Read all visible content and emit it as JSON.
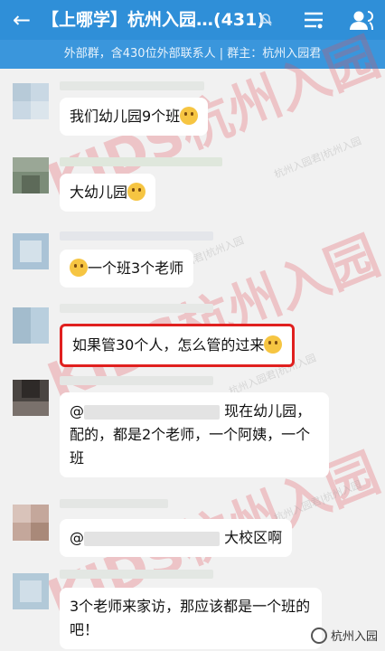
{
  "header": {
    "back_icon": "arrow-left-icon",
    "title": "【上哪学】杭州入园…(431)",
    "mute_icon": "mute-bell-icon",
    "menu_icon": "menu-lines-icon",
    "member_icon": "person-icon",
    "subtitle": "外部群，含430位外部联系人 | 群主：杭州入园君"
  },
  "messages": [
    {
      "text": "我们幼儿园9个班",
      "emoji": "shy-emoji-icon"
    },
    {
      "text": "大幼儿园",
      "emoji": "grin-emoji-icon"
    },
    {
      "emoji": "shy-emoji-icon",
      "text": "一个班3个老师"
    },
    {
      "text": "如果管30个人，怎么管的过来",
      "emoji": "shy-emoji-icon",
      "highlighted": true
    },
    {
      "mention": "@",
      "text": "现在幼儿园，配的，都是2个老师，一个阿姨，一个班"
    },
    {
      "mention": "@",
      "text": "大校区啊"
    },
    {
      "text": "3个老师来家访，那应该都是一个班的吧！"
    }
  ],
  "watermarks": {
    "big": "KIDS杭州入园",
    "small": "杭州入园君|杭州入园"
  },
  "badge": {
    "label": "杭州入园"
  },
  "colors": {
    "header_bg": "#2f8fd8",
    "subbar_bg": "#3a96dc",
    "chat_bg": "#f1f1f1",
    "highlight_border": "#e0201f"
  }
}
